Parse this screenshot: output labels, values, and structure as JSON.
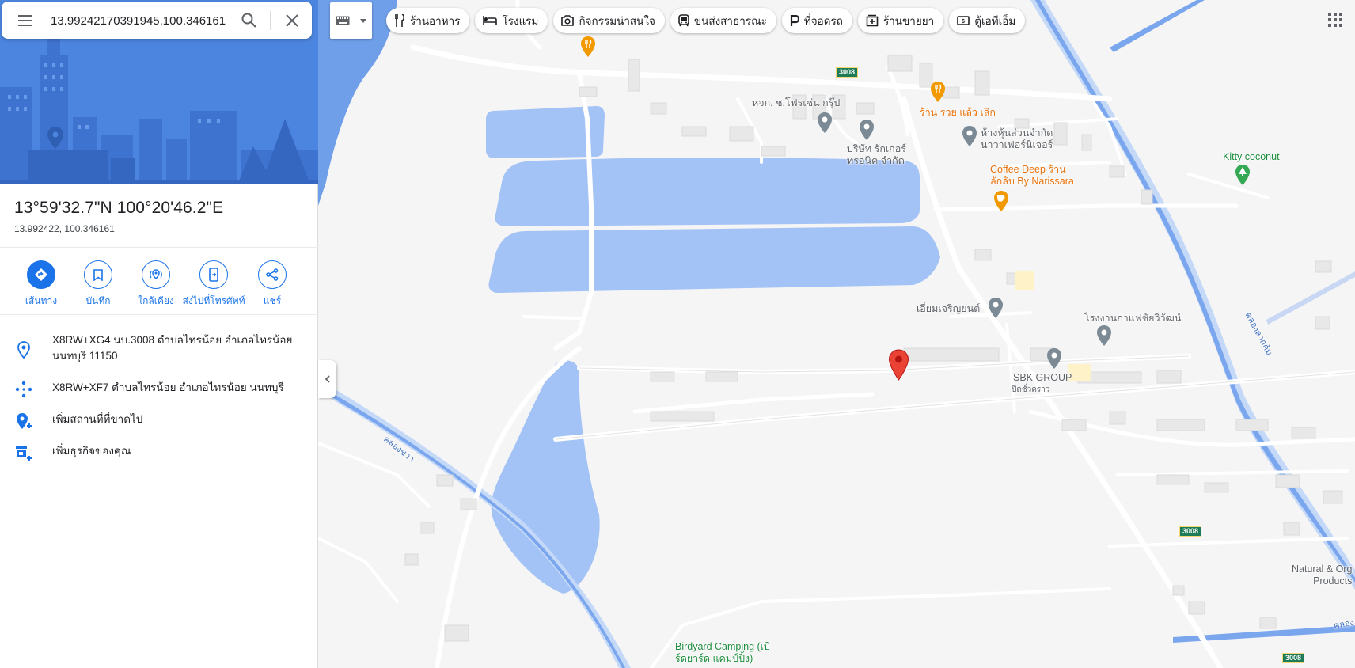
{
  "search": {
    "value": "13.99242170391945,100.346161",
    "menu_icon": "menu-icon",
    "search_icon": "search-icon",
    "close_icon": "close-icon"
  },
  "place": {
    "title": "13°59'32.7\"N 100°20'46.2\"E",
    "decimal": "13.992422, 100.346161"
  },
  "actions": [
    {
      "label": "เส้นทาง",
      "icon": "directions-icon"
    },
    {
      "label": "บันทึก",
      "icon": "bookmark-icon"
    },
    {
      "label": "ใกล้เคียง",
      "icon": "nearby-icon"
    },
    {
      "label": "ส่งไปที่โทรศัพท์",
      "icon": "send-to-phone-icon"
    },
    {
      "label": "แชร์",
      "icon": "share-icon"
    }
  ],
  "info": [
    {
      "icon": "location-pin-icon",
      "text": "X8RW+XG4 นบ.3008 ตำบลไทรน้อย อำเภอไทรน้อย นนทบุรี 11150"
    },
    {
      "icon": "plus-code-icon",
      "text": "X8RW+XF7 ตำบลไทรน้อย อำเภอไทรน้อย นนทบุรี"
    },
    {
      "icon": "add-place-icon",
      "text": "เพิ่มสถานที่ที่ขาดไป"
    },
    {
      "icon": "add-business-icon",
      "text": "เพิ่มธุรกิจของคุณ"
    }
  ],
  "chips": [
    {
      "label": "ร้านอาหาร",
      "icon": "restaurant-icon"
    },
    {
      "label": "โรงแรม",
      "icon": "hotel-icon"
    },
    {
      "label": "กิจกรรมน่าสนใจ",
      "icon": "camera-icon"
    },
    {
      "label": "ขนส่งสาธารณะ",
      "icon": "transit-icon"
    },
    {
      "label": "ที่จอดรถ",
      "icon": "parking-icon"
    },
    {
      "label": "ร้านขายยา",
      "icon": "pharmacy-icon"
    },
    {
      "label": "ตู้เอทีเอ็ม",
      "icon": "atm-icon"
    }
  ],
  "map_labels": {
    "hjk": "หจก. ช.โฟรเซ่น กรุ๊ป",
    "borisat": "บริษัท รักเกอร์\nทรอนิค จำกัด",
    "ran_ruay": "ร้าน รวย แล้ว เลิก",
    "hang_hun": "ห้างหุ้นส่วนจำกัด\nนาวาเฟอร์นิเจอร์",
    "coffee": "Coffee Deep ร้าน\nลักลับ By Narissara",
    "kitty": "Kitty coconut",
    "iam": "เอี่ยมเจริญยนต์",
    "factory": "โรงงานกาแฟชัยวิวัฒน์",
    "sbk": "SBK GROUP",
    "sbk_sub": "ปิดชั่วคราว",
    "canal_right": "คลองลากค้ม",
    "canal_left": "คลองขวา",
    "canal_br": "คลอง",
    "natural": "Natural & Org\nProducts",
    "birdyard": "Birdyard Camping (เบิ\nร์ดยาร์ด แคมป์ปิ้ง)",
    "route": "3008"
  }
}
